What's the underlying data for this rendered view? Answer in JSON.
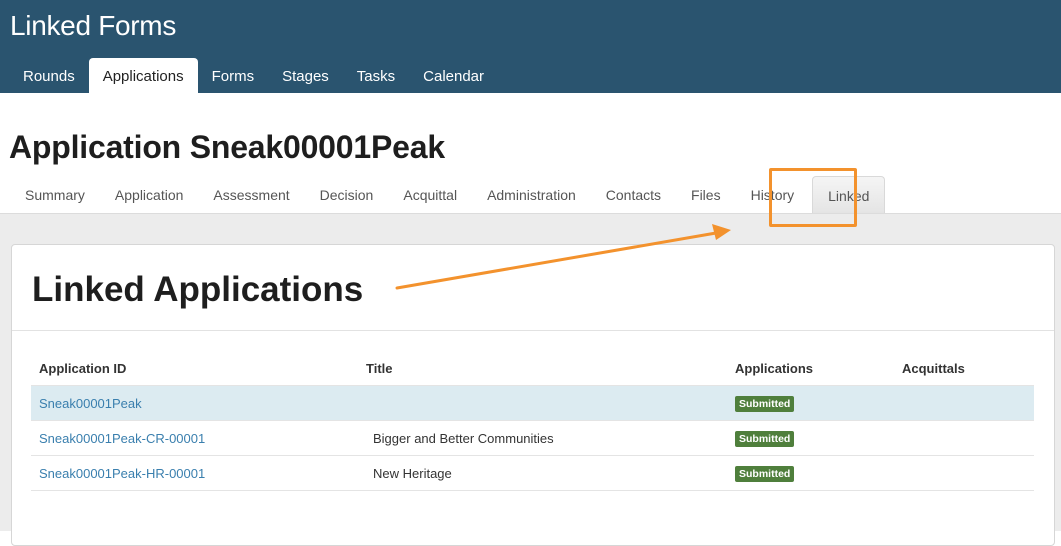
{
  "header": {
    "app_title": "Linked Forms",
    "nav": [
      {
        "label": "Rounds",
        "active": false
      },
      {
        "label": "Applications",
        "active": true
      },
      {
        "label": "Forms",
        "active": false
      },
      {
        "label": "Stages",
        "active": false
      },
      {
        "label": "Tasks",
        "active": false
      },
      {
        "label": "Calendar",
        "active": false
      }
    ]
  },
  "page": {
    "title": "Application Sneak00001Peak",
    "tabs": [
      {
        "label": "Summary",
        "active": false
      },
      {
        "label": "Application",
        "active": false
      },
      {
        "label": "Assessment",
        "active": false
      },
      {
        "label": "Decision",
        "active": false
      },
      {
        "label": "Acquittal",
        "active": false
      },
      {
        "label": "Administration",
        "active": false
      },
      {
        "label": "Contacts",
        "active": false
      },
      {
        "label": "Files",
        "active": false
      },
      {
        "label": "History",
        "active": false
      },
      {
        "label": "Linked",
        "active": true
      }
    ]
  },
  "panel": {
    "heading": "Linked Applications",
    "columns": [
      "Application ID",
      "Title",
      "Applications",
      "Acquittals"
    ],
    "rows": [
      {
        "id": "Sneak00001Peak",
        "title": "",
        "application_status": "Submitted",
        "acquittal_status": "",
        "selected": true
      },
      {
        "id": "Sneak00001Peak-CR-00001",
        "title": "Bigger and Better Communities",
        "application_status": "Submitted",
        "acquittal_status": "",
        "selected": false
      },
      {
        "id": "Sneak00001Peak-HR-00001",
        "title": "New Heritage",
        "application_status": "Submitted",
        "acquittal_status": "",
        "selected": false
      }
    ]
  },
  "annotation": {
    "color": "#f3922d"
  },
  "colors": {
    "header_bg": "#2a546f",
    "link": "#3a7fae",
    "badge": "#4f7f3c",
    "selected_row": "#dcebf1"
  }
}
